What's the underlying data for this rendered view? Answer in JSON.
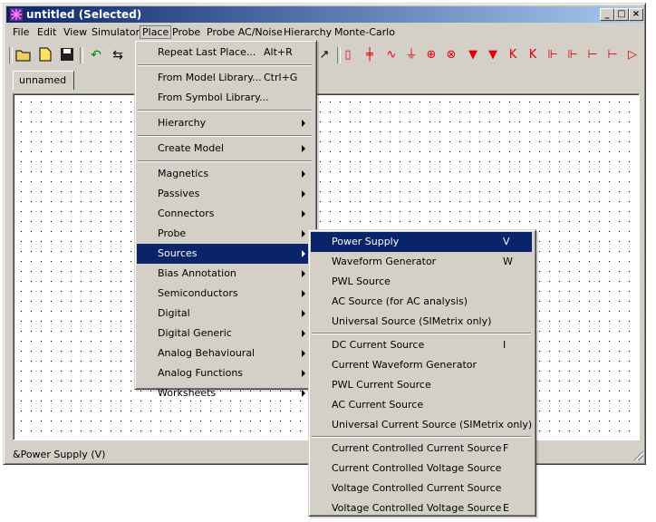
{
  "window": {
    "title": "untitled (Selected)"
  },
  "title_buttons": [
    "_",
    "□",
    "×"
  ],
  "menubar": [
    "File",
    "Edit",
    "View",
    "Simulator",
    "Place",
    "Probe",
    "Probe AC/Noise",
    "Hierarchy",
    "Monte-Carlo"
  ],
  "active_menu": "Place",
  "toolbar": {
    "left_icons": [
      "open-folder-icon",
      "new-file-icon",
      "save-icon",
      "undo-icon",
      "flip-icon"
    ],
    "component_icons": [
      "resistor-icon",
      "capacitor-icon",
      "inductor-icon",
      "ground-icon",
      "source-icon",
      "current-source-icon",
      "diode-icon",
      "zener-icon",
      "npn-icon",
      "pnp-icon",
      "nmos-icon",
      "pmos-icon",
      "jfet-icon",
      "opamp-icon"
    ]
  },
  "tab": {
    "label": "unnamed"
  },
  "status": {
    "text": "&Power Supply (V)"
  },
  "place_menu": [
    {
      "label": "Repeat Last Place...",
      "shortcut": "Alt+R"
    },
    {
      "sep": true
    },
    {
      "label": "From Model Library...",
      "shortcut": "Ctrl+G"
    },
    {
      "label": "From Symbol Library..."
    },
    {
      "sep": true
    },
    {
      "label": "Hierarchy",
      "submenu": true
    },
    {
      "sep": true
    },
    {
      "label": "Create Model",
      "submenu": true
    },
    {
      "sep": true
    },
    {
      "label": "Magnetics",
      "submenu": true
    },
    {
      "label": "Passives",
      "submenu": true
    },
    {
      "label": "Connectors",
      "submenu": true
    },
    {
      "label": "Probe",
      "submenu": true
    },
    {
      "label": "Sources",
      "submenu": true,
      "highlight": true
    },
    {
      "label": "Bias Annotation",
      "submenu": true
    },
    {
      "label": "Semiconductors",
      "submenu": true
    },
    {
      "label": "Digital",
      "submenu": true
    },
    {
      "label": "Digital Generic",
      "submenu": true
    },
    {
      "label": "Analog Behavioural",
      "submenu": true
    },
    {
      "label": "Analog Functions",
      "submenu": true
    },
    {
      "label": "Worksheets",
      "submenu": true
    }
  ],
  "sources_menu": [
    {
      "label": "Power Supply",
      "shortcut": "V",
      "highlight": true
    },
    {
      "label": "Waveform Generator",
      "shortcut": "W"
    },
    {
      "label": "PWL Source"
    },
    {
      "label": "AC Source (for AC analysis)"
    },
    {
      "label": "Universal Source (SIMetrix only)"
    },
    {
      "sep": true
    },
    {
      "label": "DC Current Source",
      "shortcut": "I"
    },
    {
      "label": "Current Waveform Generator"
    },
    {
      "label": "PWL Current Source"
    },
    {
      "label": "AC Current Source"
    },
    {
      "label": "Universal Current Source (SIMetrix only)"
    },
    {
      "sep": true
    },
    {
      "label": "Current Controlled Current Source",
      "shortcut": "F"
    },
    {
      "label": "Current Controlled Voltage Source"
    },
    {
      "label": "Voltage Controlled Current Source"
    },
    {
      "label": "Voltage Controlled Voltage Source",
      "shortcut": "E"
    }
  ]
}
